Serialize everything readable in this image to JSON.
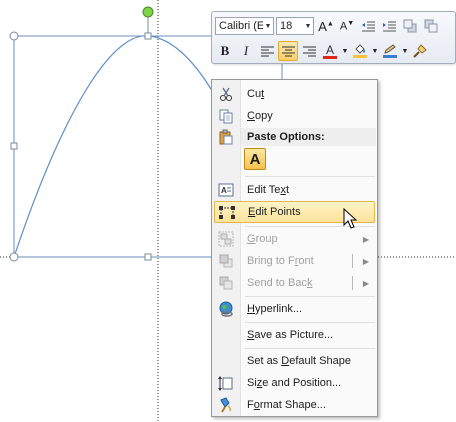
{
  "mini_toolbar": {
    "font_name": "Calibri (E",
    "font_size": "18",
    "grow_font": "A",
    "shrink_font": "A",
    "bold": "B",
    "italic": "I",
    "font_color_letter": "A"
  },
  "context_menu": {
    "cut": {
      "pre": "Cu",
      "u": "t",
      "post": ""
    },
    "copy": {
      "pre": "",
      "u": "C",
      "post": "opy"
    },
    "paste_options": {
      "pre": "Paste Options:",
      "u": "",
      "post": ""
    },
    "paste_keep_text": "A",
    "edit_text": {
      "pre": "Edit Te",
      "u": "x",
      "post": "t"
    },
    "edit_points": {
      "pre": "",
      "u": "E",
      "post": "dit Points"
    },
    "group": {
      "pre": "",
      "u": "G",
      "post": "roup"
    },
    "bring_to_front": {
      "pre": "Bring to F",
      "u": "r",
      "post": "ont"
    },
    "send_to_back": {
      "pre": "Send to Bac",
      "u": "k",
      "post": ""
    },
    "hyperlink": {
      "pre": "",
      "u": "H",
      "post": "yperlink..."
    },
    "save_as_picture": {
      "pre": "",
      "u": "S",
      "post": "ave as Picture..."
    },
    "set_default_shape": {
      "pre": "Set as ",
      "u": "D",
      "post": "efault Shape"
    },
    "size_and_position": {
      "pre": "Si",
      "u": "z",
      "post": "e and Position..."
    },
    "format_shape": {
      "pre": "F",
      "u": "o",
      "post": "rmat Shape..."
    }
  },
  "colors": {
    "curve": "#5b8ec7",
    "highlight": "#fde39a",
    "rotation_handle": "#7ed348"
  },
  "icons": [
    "scissors-icon",
    "copy-icon",
    "paste-icon",
    "text-box-icon",
    "edit-points-icon",
    "group-icon",
    "bring-front-icon",
    "send-back-icon",
    "hyperlink-globe-icon",
    "size-position-icon",
    "format-shape-icon",
    "mouse-pointer-icon"
  ]
}
